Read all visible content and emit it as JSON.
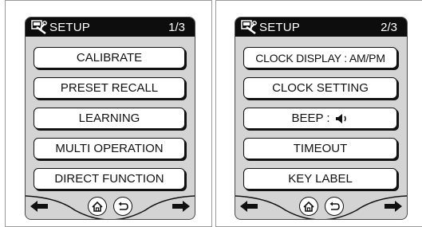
{
  "screens": [
    {
      "title": "SETUP",
      "page": "1/3",
      "items": [
        "CALIBRATE",
        "PRESET RECALL",
        "LEARNING",
        "MULTI OPERATION",
        "DIRECT FUNCTION"
      ]
    },
    {
      "title": "SETUP",
      "page": "2/3",
      "items": [
        "CLOCK DISPLAY : AM/PM",
        "CLOCK SETTING",
        "BEEP :",
        "TIMEOUT",
        "KEY LABEL"
      ]
    }
  ],
  "icons": {
    "title": "setup-tools-icon",
    "speaker": "speaker-icon",
    "prev": "left-arrow-icon",
    "next": "right-arrow-icon",
    "home": "home-icon",
    "back": "back-icon"
  }
}
